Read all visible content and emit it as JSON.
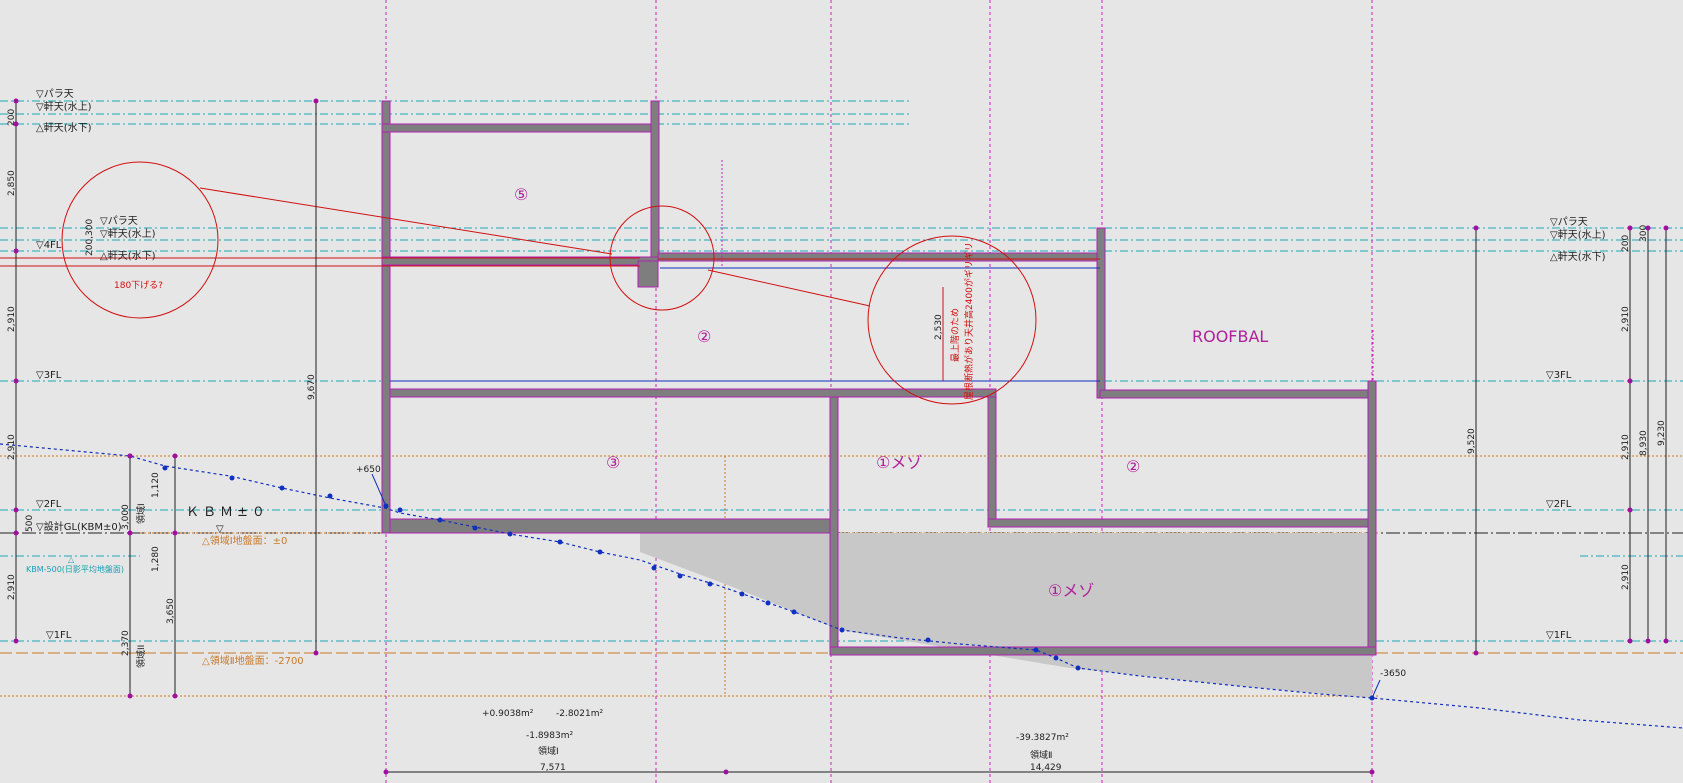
{
  "levels_left": {
    "para": "▽パラ天",
    "eave_up": "▽軒天(水上)",
    "eave_down": "△軒天(水下)",
    "fl4": "▽4FL",
    "fl3": "▽3FL",
    "fl2": "▽2FL",
    "design_gl": "▽設計GL(KBM±0)",
    "fl1": "▽1FL"
  },
  "levels_right": {
    "para": "▽パラ天",
    "eave_up": "▽軒天(水上)",
    "eave_down": "△軒天(水下)",
    "fl3": "▽3FL",
    "fl2": "▽2FL",
    "fl1": "▽1FL"
  },
  "detail_callout": {
    "para": "▽パラ天",
    "eave_up": "▽軒天(水上)",
    "eave_down": "△軒天(水下)",
    "dim": "200,300",
    "note": "180下げる?"
  },
  "left_dims": {
    "d200": "200",
    "d2850": "2,850",
    "d2910_a": "2,910",
    "d2910_b": "2,910",
    "d500": "500",
    "d2910_c": "2,910",
    "total": "9,670",
    "d1120": "1,120",
    "d1280": "1,280",
    "d3000": "3,000",
    "d3650": "3,650",
    "d2370": "2,370",
    "zone1_v": "領域I",
    "zone2_v": "領域II"
  },
  "right_dims": {
    "d200": "200",
    "d300": "300",
    "d2910_a": "2,910",
    "d2910_b": "2,910",
    "d2910_c": "2,910",
    "d8930": "8,930",
    "d9230": "9,230",
    "d9520": "9,520"
  },
  "kbm": {
    "label": "ＫＢＭ±０",
    "marker": "▽",
    "avg_marker": "△",
    "avg": "KBM-500(日影平均地盤面)"
  },
  "zones": {
    "zone1_ground": "△領域Ⅰ地盤面：±0",
    "zone2_ground": "△領域Ⅱ地盤面：-2700",
    "zone1_label": "領域Ⅰ",
    "zone2_label": "領域Ⅱ",
    "zone1_width": "7,571",
    "zone2_width": "14,429"
  },
  "areas": {
    "a1": "+0.9038m²",
    "a2": "-2.8021m²",
    "a3": "-1.8983m²",
    "a4": "-39.3827m²"
  },
  "ground_marks": {
    "plus650": "+650",
    "minus3650": "-3650"
  },
  "rooms": {
    "r5": "⑤",
    "r2_top": "②",
    "roofbal": "ROOFBAL",
    "r3": "③",
    "r1_mid": "①メゾ",
    "r2_right": "②",
    "r1_low": "①メゾ"
  },
  "note_red": {
    "dim": "2,530",
    "line1": "最上階のため",
    "line2": "屋根断熱があり天井高2400がギリギリ"
  },
  "colors": {
    "background": "#e6e6e6",
    "wall": "#7e7e7e",
    "outline": "#b020b0",
    "cyan": "#1aa8b8",
    "orange": "#c87a2a",
    "red": "#d01010",
    "blue": "#1030c0"
  }
}
